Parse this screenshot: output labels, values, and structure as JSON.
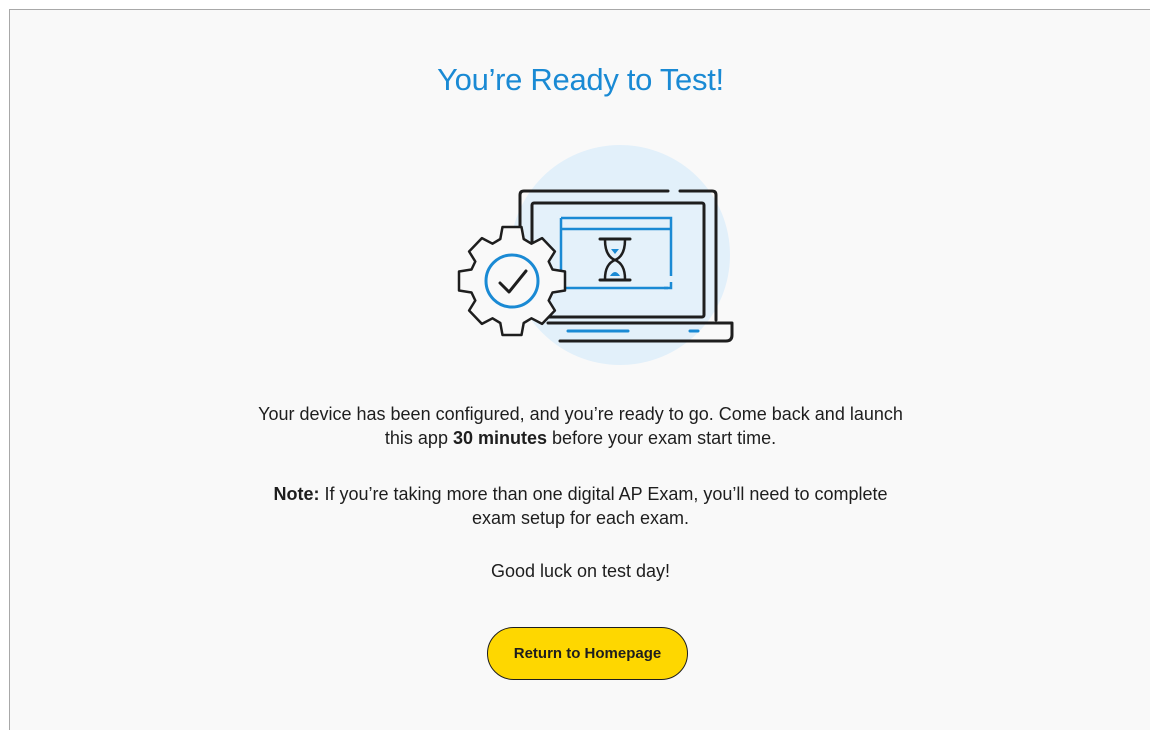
{
  "title": "You’re Ready to Test!",
  "illustration": {
    "icons": [
      "laptop-icon",
      "hourglass-icon",
      "gear-check-icon"
    ],
    "colors": {
      "accent": "#1a8ad4",
      "circle_bg": "#e2f0fa",
      "screen_bg": "#e4f1fa",
      "outline": "#1e1e1e"
    }
  },
  "message": {
    "line1_before": "Your device has been configured, and you’re ready to go. Come back and launch this app ",
    "line1_bold": "30 minutes",
    "line1_after": " before your exam start time.",
    "note_label": "Note:",
    "note_text": " If you’re taking more than one digital AP Exam, you’ll need to complete exam setup for each exam.",
    "closing": "Good luck on test day!"
  },
  "button": {
    "label": "Return to Homepage",
    "color": "#fed700"
  }
}
